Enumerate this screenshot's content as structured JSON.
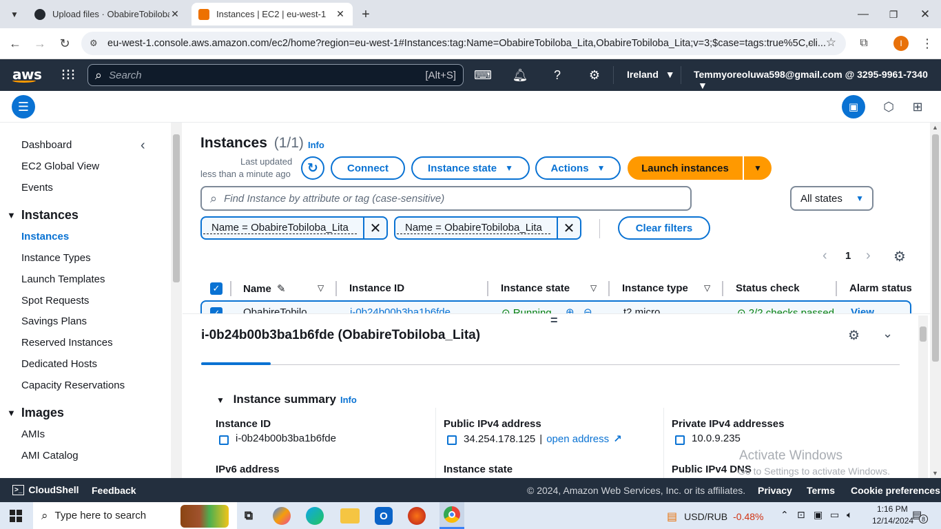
{
  "browser": {
    "tabs": [
      {
        "label": "Upload files · ObabireTobiloba/",
        "active": false
      },
      {
        "label": "Instances | EC2 | eu-west-1",
        "active": true
      }
    ],
    "url": "eu-west-1.console.aws.amazon.com/ec2/home?region=eu-west-1#Instances:tag:Name=ObabireTobiloba_Lita,ObabireTobiloba_Lita;v=3;$case=tags:true%5C,cli...",
    "profile_initial": "I"
  },
  "awsnav": {
    "logo": "aws",
    "search_placeholder": "Search",
    "search_shortcut": "[Alt+S]",
    "region": "Ireland",
    "account": "Temmyoreoluwa598@gmail.com @ 3295-9961-7340"
  },
  "sidebar": {
    "top_items": [
      "Dashboard",
      "EC2 Global View",
      "Events"
    ],
    "instances_heading": "Instances",
    "instances_items": [
      "Instances",
      "Instance Types",
      "Launch Templates",
      "Spot Requests",
      "Savings Plans",
      "Reserved Instances",
      "Dedicated Hosts",
      "Capacity Reservations"
    ],
    "images_heading": "Images",
    "images_items": [
      "AMIs",
      "AMI Catalog"
    ]
  },
  "main": {
    "title": "Instances",
    "count": "(1/1)",
    "info": "Info",
    "last_updated_line1": "Last updated",
    "last_updated_line2": "less than a minute ago",
    "connect_label": "Connect",
    "instance_state_label": "Instance state",
    "actions_label": "Actions",
    "launch_label": "Launch instances",
    "search_placeholder": "Find Instance by attribute or tag (case-sensitive)",
    "states_select": "All states",
    "filters": [
      "Name = ObabireTobiloba_Lita",
      "Name = ObabireTobiloba_Lita"
    ],
    "clear_filters": "Clear filters",
    "page_number": "1",
    "columns": [
      "Name",
      "Instance ID",
      "Instance state",
      "Instance type",
      "Status check",
      "Alarm status"
    ],
    "row": {
      "name": "ObabireTobilo",
      "instance_id": "i-0b24b00b3ba1b6fde",
      "state": "Running",
      "type": "t2.micro",
      "status_check": "2/2 checks passed",
      "alarm": "View alarms"
    }
  },
  "details": {
    "title": "i-0b24b00b3ba1b6fde (ObabireTobiloba_Lita)",
    "summary_heading": "Instance summary",
    "summary_info": "Info",
    "instance_id_label": "Instance ID",
    "instance_id_value": "i-0b24b00b3ba1b6fde",
    "public_ipv4_label": "Public IPv4 address",
    "public_ipv4_value": "34.254.178.125",
    "open_address": "open address",
    "private_ipv4_label": "Private IPv4 addresses",
    "private_ipv4_value": "10.0.9.235",
    "ipv6_label": "IPv6 address",
    "instance_state_label": "Instance state",
    "public_dns_label": "Public IPv4 DNS"
  },
  "watermark": {
    "line1": "Activate Windows",
    "line2": "Go to Settings to activate Windows."
  },
  "footer": {
    "cloudshell": "CloudShell",
    "feedback": "Feedback",
    "copyright": "© 2024, Amazon Web Services, Inc. or its affiliates.",
    "privacy": "Privacy",
    "terms": "Terms",
    "cookies": "Cookie preferences"
  },
  "taskbar": {
    "search_placeholder": "Type here to search",
    "currency": "USD/RUB",
    "currency_change": "-0.48%",
    "time": "1:16 PM",
    "date": "12/14/2024",
    "notifications": "8"
  },
  "colors": {
    "aws_nav": "#232f3e",
    "primary_blue": "#0972d3",
    "launch_orange": "#ff9900",
    "running_green": "#037f0c",
    "negative_red": "#d13212"
  }
}
